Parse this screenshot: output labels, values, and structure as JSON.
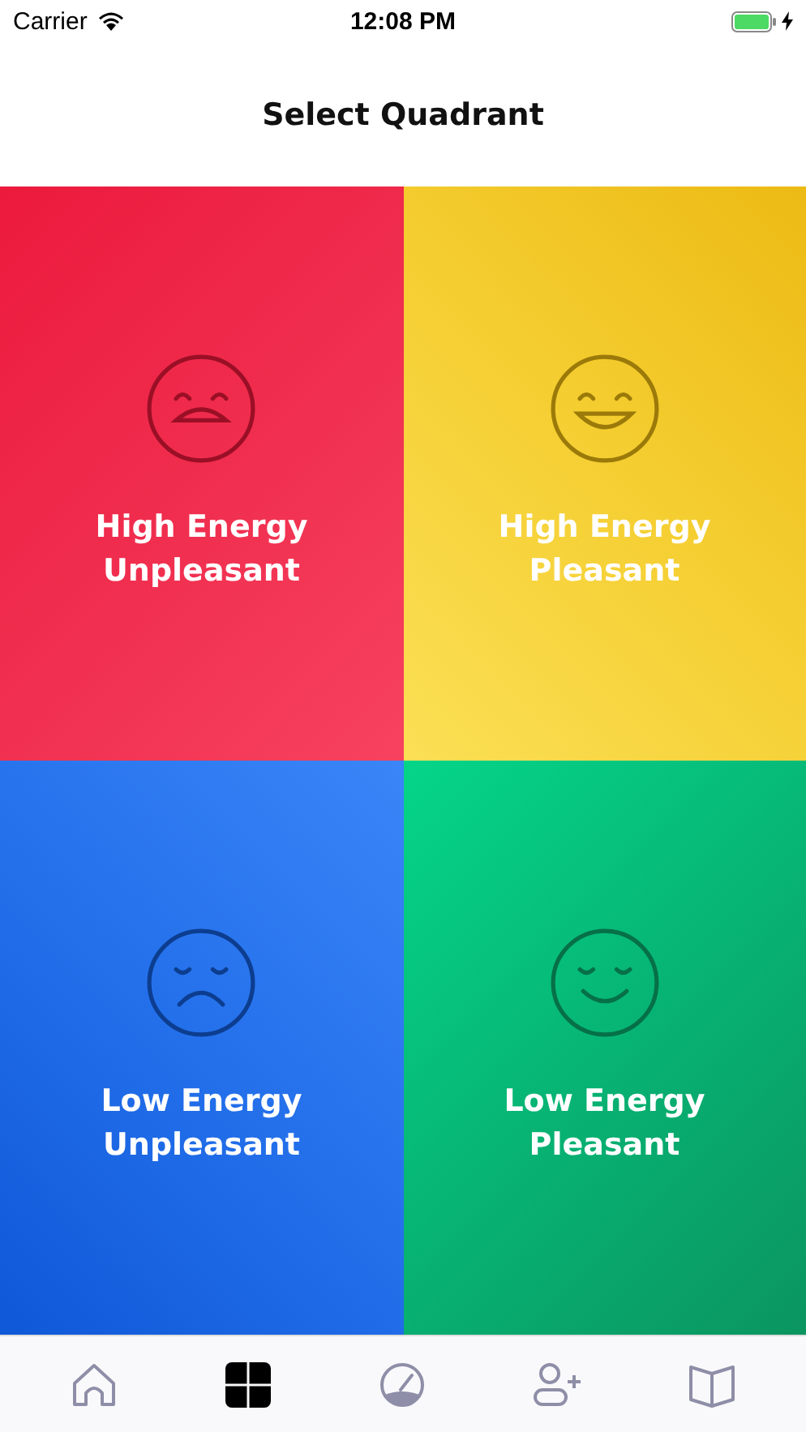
{
  "status_bar": {
    "carrier": "Carrier",
    "time": "12:08 PM"
  },
  "header": {
    "title": "Select Quadrant"
  },
  "quadrants": [
    {
      "kind": "high-unpleasant",
      "line1": "High Energy",
      "line2": "Unpleasant"
    },
    {
      "kind": "high-pleasant",
      "line1": "High Energy",
      "line2": "Pleasant"
    },
    {
      "kind": "low-unpleasant",
      "line1": "Low Energy",
      "line2": "Unpleasant"
    },
    {
      "kind": "low-pleasant",
      "line1": "Low Energy",
      "line2": "Pleasant"
    }
  ],
  "tab_bar": [
    {
      "kind": "home",
      "selected": false
    },
    {
      "kind": "grid",
      "selected": true
    },
    {
      "kind": "gauge",
      "selected": false
    },
    {
      "kind": "add-person",
      "selected": false
    },
    {
      "kind": "book",
      "selected": false
    }
  ]
}
